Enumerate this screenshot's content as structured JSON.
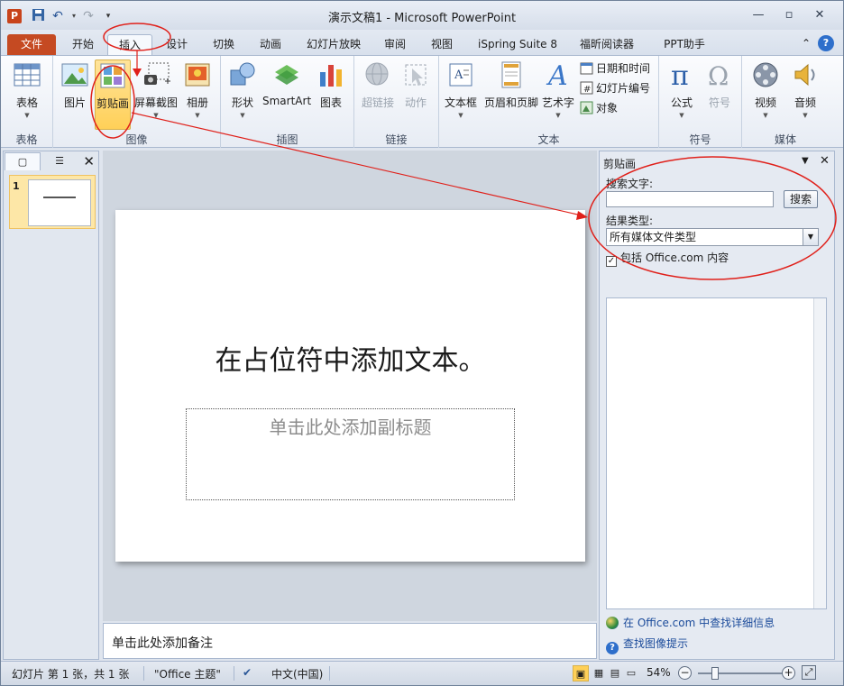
{
  "window": {
    "title": "演示文稿1 - Microsoft PowerPoint",
    "app_icon": "P",
    "controls": [
      "minimize-icon",
      "maximize-icon",
      "close-icon"
    ]
  },
  "quick_access": {
    "icons": [
      "save-icon",
      "undo-icon",
      "redo-icon",
      "customize-icon"
    ]
  },
  "tabs": {
    "file": "文件",
    "home": "开始",
    "insert": "插入",
    "design": "设计",
    "transitions": "切换",
    "animations": "动画",
    "slideshow": "幻灯片放映",
    "review": "审阅",
    "view": "视图",
    "ispring": "iSpring Suite 8",
    "foxit": "福昕阅读器",
    "ppt_helper": "PPT助手",
    "active": "插入"
  },
  "ribbon": {
    "groups": {
      "tables": "表格",
      "images": "图像",
      "illustrations": "插图",
      "links": "链接",
      "text": "文本",
      "symbols": "符号",
      "media": "媒体"
    },
    "buttons": {
      "table": "表格",
      "picture": "图片",
      "clipart": "剪贴画",
      "screenshot": "屏幕截图",
      "album": "相册",
      "shapes": "形状",
      "smartart": "SmartArt",
      "chart": "图表",
      "hyperlink": "超链接",
      "action": "动作",
      "textbox": "文本框",
      "header_footer": "页眉和页脚",
      "wordart": "艺术字",
      "datetime": "日期和时间",
      "slide_number": "幻灯片编号",
      "object": "对象",
      "equation": "公式",
      "symbol": "符号",
      "video": "视频",
      "audio": "音频"
    }
  },
  "slides_panel": {
    "slide_number": "1"
  },
  "slide": {
    "title": "在占位符中添加文本。",
    "subtitle_placeholder": "单击此处添加副标题"
  },
  "notes": {
    "placeholder": "单击此处添加备注"
  },
  "clip_pane": {
    "title": "剪贴画",
    "search_label": "搜索文字:",
    "search_value": "",
    "search_button": "搜索",
    "result_type_label": "结果类型:",
    "result_type_value": "所有媒体文件类型",
    "include_office": "包括 Office.com 内容",
    "include_checked": true,
    "link_office": "在 Office.com 中查找详细信息",
    "link_tips": "查找图像提示"
  },
  "statusbar": {
    "slide_info": "幻灯片 第 1 张，共 1 张",
    "theme": "\"Office 主题\"",
    "language": "中文(中国)",
    "zoom": "54%"
  },
  "colors": {
    "file_tab": "#c54a22",
    "highlight": "#ffd058",
    "annotation": "#e0201a"
  }
}
